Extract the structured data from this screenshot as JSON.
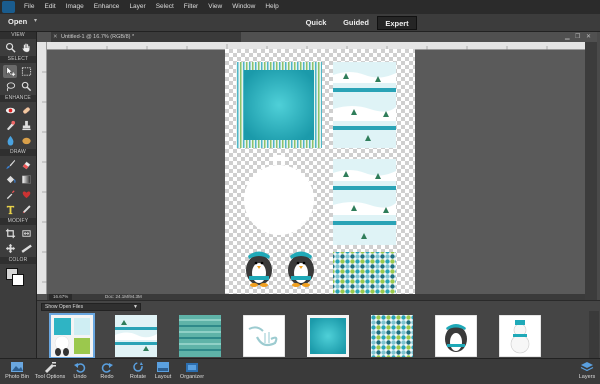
{
  "menubar": {
    "items": [
      "File",
      "Edit",
      "Image",
      "Enhance",
      "Layer",
      "Select",
      "Filter",
      "View",
      "Window",
      "Help"
    ]
  },
  "modebar": {
    "open_label": "Open",
    "tabs": [
      {
        "label": "Quick",
        "active": false
      },
      {
        "label": "Guided",
        "active": false
      },
      {
        "label": "Expert",
        "active": true
      }
    ]
  },
  "toolbox": {
    "sections": {
      "view": "VIEW",
      "select": "SELECT",
      "enhance": "ENHANCE",
      "draw": "DRAW",
      "modify": "MODIFY",
      "color": "COLOR"
    }
  },
  "document": {
    "tab_title": "Untitled-1 @ 16.7% (RGB/8) *",
    "zoom": "16.67%",
    "doc_size": "Doc: 24.1M/94.3M"
  },
  "photo_bin": {
    "select_label": "Show Open Files",
    "thumb_count": 8,
    "selected_index": 0
  },
  "bottombar": {
    "photo_bin": "Photo Bin",
    "tool_options": "Tool Options",
    "undo": "Undo",
    "redo": "Redo",
    "rotate": "Rotate",
    "layout": "Layout",
    "organizer": "Organizer",
    "layers": "Layers"
  },
  "colors": {
    "accent": "#6aa7e0",
    "teal": "#2fb4c4",
    "active_tab": "#252525"
  }
}
